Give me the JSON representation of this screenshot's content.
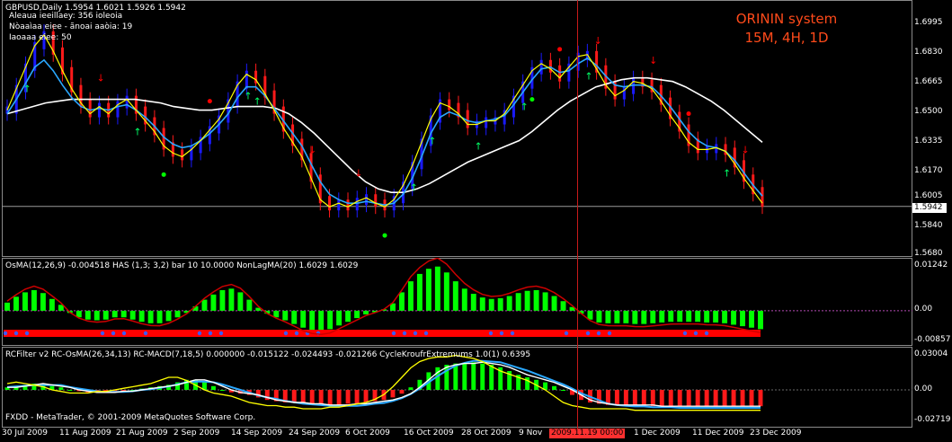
{
  "colors": {
    "background": "#000000",
    "bull_candle": "#1a1aff",
    "bear_candle": "#ff1a1a",
    "hist_pos": "#00ff00",
    "hist_neg": "#00ff00",
    "signal_red": "#ff0000",
    "accent": "#ff4a1a"
  },
  "main": {
    "symbol_header": "GBPUSD,Daily  1.5954 1.6021 1.5926 1.5942",
    "info_lines": [
      "Aleaua ieeillaey: 356 ioleoia",
      "Nòaaìaa eiee - ãnoai aaòia: 19",
      "Iaoaaa eiee: 50"
    ],
    "brand_title": "ORININ system",
    "brand_sub": "15M, 4H, 1D",
    "current_price": "1.5942",
    "price_labels": [
      "1.6995",
      "1.6830",
      "1.6665",
      "1.6500",
      "1.6335",
      "1.6170",
      "1.6005",
      "1.5840",
      "1.5680"
    ]
  },
  "osma": {
    "header": "OsMA(12,26,9) -0.004518  HAS (1,3; 3,2) bar 10 10.0000  NonLagMA(20) 1.6029 1.6029",
    "labels": [
      "0.01242",
      "0.00",
      "-0.00857"
    ]
  },
  "rcf": {
    "header": "RCFilter v2  RC-OsMA(26,34,13) RC-MACD(7,18,5) 0.000000 -0.015122 -0.024493 -0.021266  CycleKroufrExtremums 1.0(1) 0.6395",
    "labels": [
      "0.03004",
      "0.00",
      "-0.02719"
    ],
    "copyright": "FXDD - MetaTrader, © 2001-2009 MetaQuotes Software Corp."
  },
  "time_axis": {
    "dates": [
      "30 Jul 2009",
      "11 Aug 2009",
      "21 Aug 2009",
      "2 Sep 2009",
      "14 Sep 2009",
      "24 Sep 2009",
      "6 Oct 2009",
      "16 Oct 2009",
      "28 Oct 2009",
      "9 Nov",
      "1 Dec 2009",
      "11 Dec 2009",
      "23 Dec 2009"
    ],
    "crosshair_date": "2009.11.19 00:00"
  },
  "chart_data": [
    {
      "type": "line",
      "title": "GBPUSD,Daily",
      "ylim": [
        1.568,
        1.7075
      ],
      "series": [
        {
          "values": [
            1.648,
            1.66,
            1.672,
            1.684,
            1.69,
            1.681,
            1.67,
            1.66,
            1.652,
            1.646,
            1.65,
            1.646,
            1.651,
            1.654,
            1.648,
            1.642,
            1.636,
            1.628,
            1.624,
            1.622,
            1.626,
            1.631,
            1.637,
            1.643,
            1.652,
            1.662,
            1.668,
            1.665,
            1.657,
            1.648,
            1.638,
            1.63,
            1.622,
            1.61,
            1.598,
            1.594,
            1.596,
            1.594,
            1.597,
            1.599,
            1.596,
            1.594,
            1.598,
            1.606,
            1.617,
            1.63,
            1.643,
            1.652,
            1.65,
            1.646,
            1.64,
            1.64,
            1.642,
            1.642,
            1.646,
            1.654,
            1.662,
            1.67,
            1.674,
            1.671,
            1.666,
            1.672,
            1.678,
            1.679,
            1.671,
            1.662,
            1.656,
            1.659,
            1.664,
            1.663,
            1.66,
            1.653,
            1.645,
            1.638,
            1.63,
            1.626,
            1.626,
            1.627,
            1.625,
            1.618,
            1.61,
            1.603,
            1.596
          ]
        },
        {
          "values": [
            1.646,
            1.654,
            1.663,
            1.672,
            1.676,
            1.67,
            1.662,
            1.655,
            1.65,
            1.648,
            1.649,
            1.648,
            1.65,
            1.651,
            1.648,
            1.644,
            1.639,
            1.633,
            1.629,
            1.627,
            1.628,
            1.631,
            1.635,
            1.64,
            1.646,
            1.655,
            1.661,
            1.661,
            1.656,
            1.649,
            1.642,
            1.635,
            1.628,
            1.618,
            1.608,
            1.601,
            1.598,
            1.596,
            1.596,
            1.597,
            1.596,
            1.595,
            1.596,
            1.601,
            1.61,
            1.622,
            1.635,
            1.644,
            1.647,
            1.645,
            1.642,
            1.641,
            1.642,
            1.643,
            1.645,
            1.651,
            1.658,
            1.665,
            1.671,
            1.672,
            1.669,
            1.67,
            1.674,
            1.677,
            1.673,
            1.667,
            1.662,
            1.661,
            1.662,
            1.662,
            1.661,
            1.656,
            1.65,
            1.643,
            1.636,
            1.631,
            1.628,
            1.627,
            1.625,
            1.62,
            1.613,
            1.606,
            1.6
          ]
        },
        {
          "values": [
            1.646,
            1.648,
            1.65,
            1.652,
            1.653,
            1.654,
            1.654,
            1.654,
            1.654,
            1.654,
            1.654,
            1.653,
            1.652,
            1.65,
            1.649,
            1.648,
            1.648,
            1.649,
            1.65,
            1.65,
            1.65,
            1.649,
            1.646,
            1.641,
            1.635,
            1.628,
            1.621,
            1.614,
            1.608,
            1.604,
            1.602,
            1.602,
            1.604,
            1.607,
            1.611,
            1.615,
            1.619,
            1.622,
            1.625,
            1.628,
            1.631,
            1.636,
            1.642,
            1.648,
            1.653,
            1.657,
            1.661,
            1.663,
            1.665,
            1.666,
            1.666,
            1.665,
            1.664,
            1.661,
            1.657,
            1.653,
            1.648,
            1.642,
            1.636,
            1.63
          ]
        }
      ]
    },
    {
      "type": "bar",
      "title": "OsMA(12,26,9)",
      "ylim": [
        -0.00857,
        0.01242
      ],
      "values": [
        0.0022,
        0.0038,
        0.005,
        0.0056,
        0.0048,
        0.0032,
        0.0016,
        -0.0006,
        -0.0018,
        -0.0024,
        -0.0026,
        -0.0024,
        -0.0018,
        -0.0018,
        -0.0024,
        -0.003,
        -0.0034,
        -0.0034,
        -0.0028,
        -0.0018,
        -0.0006,
        0.0012,
        0.003,
        0.0044,
        0.0056,
        0.006,
        0.005,
        0.003,
        0.0008,
        -0.0008,
        -0.0018,
        -0.0026,
        -0.0036,
        -0.0046,
        -0.0052,
        -0.0054,
        -0.005,
        -0.004,
        -0.003,
        -0.002,
        -0.001,
        -0.0004,
        0.0004,
        0.002,
        0.005,
        0.008,
        0.01,
        0.0114,
        0.012,
        0.0104,
        0.008,
        0.006,
        0.0046,
        0.0036,
        0.0032,
        0.0034,
        0.004,
        0.0048,
        0.0054,
        0.0056,
        0.005,
        0.004,
        0.0026,
        0.001,
        -0.0008,
        -0.0024,
        -0.0032,
        -0.0034,
        -0.0034,
        -0.0034,
        -0.0036,
        -0.0036,
        -0.0034,
        -0.0032,
        -0.003,
        -0.003,
        -0.003,
        -0.003,
        -0.0032,
        -0.0032,
        -0.0034,
        -0.0038,
        -0.0042,
        -0.0046,
        -0.005
      ]
    },
    {
      "type": "bar",
      "title": "RC-OsMA(26,34,13)",
      "ylim": [
        -0.02719,
        0.03004
      ],
      "values": [
        0.002,
        0.003,
        0.004,
        0.005,
        0.004,
        0.003,
        0.002,
        0.0,
        -0.001,
        -0.002,
        -0.002,
        -0.002,
        -0.001,
        -0.001,
        0.0,
        0.001,
        0.002,
        0.003,
        0.004,
        0.006,
        0.008,
        0.008,
        0.006,
        0.003,
        0.0,
        -0.002,
        -0.003,
        -0.004,
        -0.006,
        -0.008,
        -0.009,
        -0.01,
        -0.01,
        -0.011,
        -0.011,
        -0.012,
        -0.012,
        -0.012,
        -0.011,
        -0.011,
        -0.01,
        -0.009,
        -0.008,
        -0.006,
        -0.003,
        0.002,
        0.008,
        0.014,
        0.018,
        0.02,
        0.021,
        0.021,
        0.022,
        0.021,
        0.02,
        0.018,
        0.015,
        0.012,
        0.01,
        0.008,
        0.006,
        0.003,
        0.0,
        -0.004,
        -0.008,
        -0.01,
        -0.011,
        -0.012,
        -0.012,
        -0.012,
        -0.012,
        -0.012,
        -0.013,
        -0.013,
        -0.013,
        -0.013,
        -0.013,
        -0.013,
        -0.013,
        -0.013,
        -0.013,
        -0.013,
        -0.013,
        -0.013,
        -0.013
      ]
    }
  ]
}
